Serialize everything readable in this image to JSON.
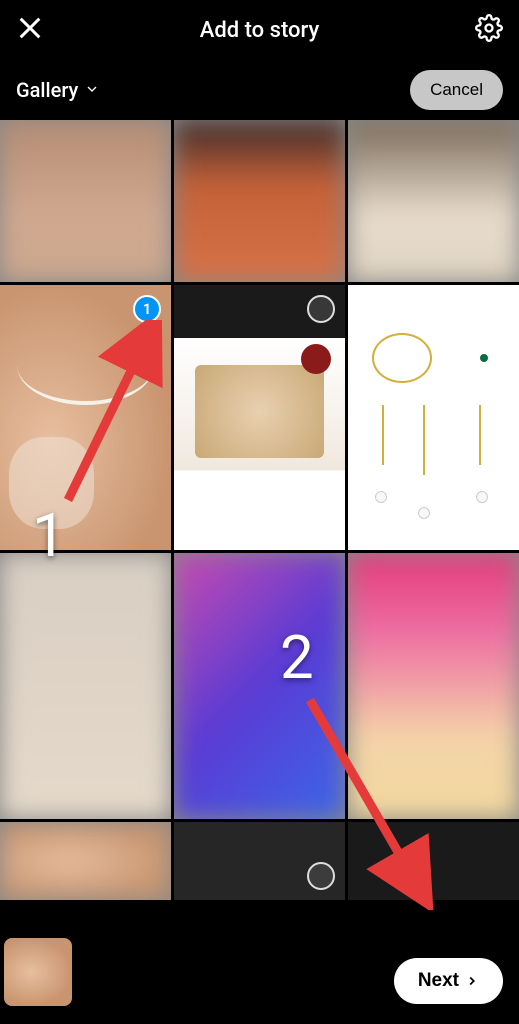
{
  "header": {
    "title": "Add to story"
  },
  "subheader": {
    "gallery_label": "Gallery",
    "cancel_label": "Cancel"
  },
  "selection": {
    "selected_index": "1"
  },
  "annotations": {
    "num1": "1",
    "num2": "2"
  },
  "footer": {
    "next_label": "Next"
  }
}
